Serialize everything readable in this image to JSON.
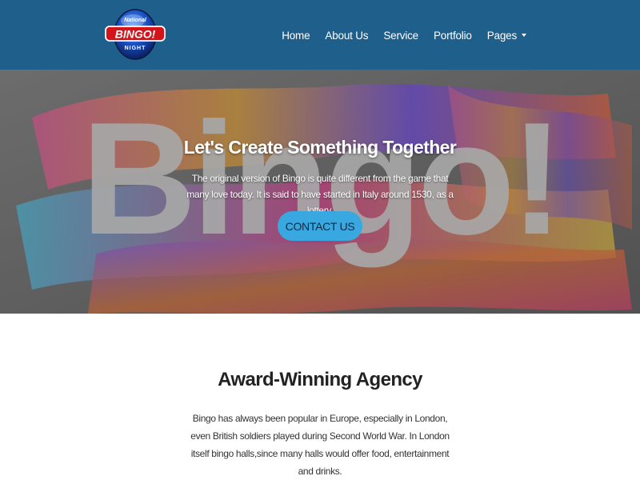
{
  "brand": {
    "logo_top": "National",
    "logo_main": "BINGO!",
    "logo_bottom": "NIGHT"
  },
  "nav": {
    "items": [
      {
        "label": "Home"
      },
      {
        "label": "About Us"
      },
      {
        "label": "Service"
      },
      {
        "label": "Portfolio"
      },
      {
        "label": "Pages",
        "has_dropdown": true
      }
    ]
  },
  "hero": {
    "background_word": "Bingo!",
    "title": "Let's Create Something Together",
    "text": "The original version of Bingo is quite different from the game that many love today. It is said to have started in Italy around 1530, as a lottery.",
    "button_label": "CONTACT US"
  },
  "about": {
    "title": "Award-Winning Agency",
    "text": "Bingo has always been popular in Europe, especially in London, even British soldiers played during Second World War. In London itself bingo halls,since many halls would offer food, entertainment and drinks."
  },
  "colors": {
    "navbar": "#1f5f8b",
    "button": "#3aa8e0",
    "button_text": "#0d2a44"
  }
}
